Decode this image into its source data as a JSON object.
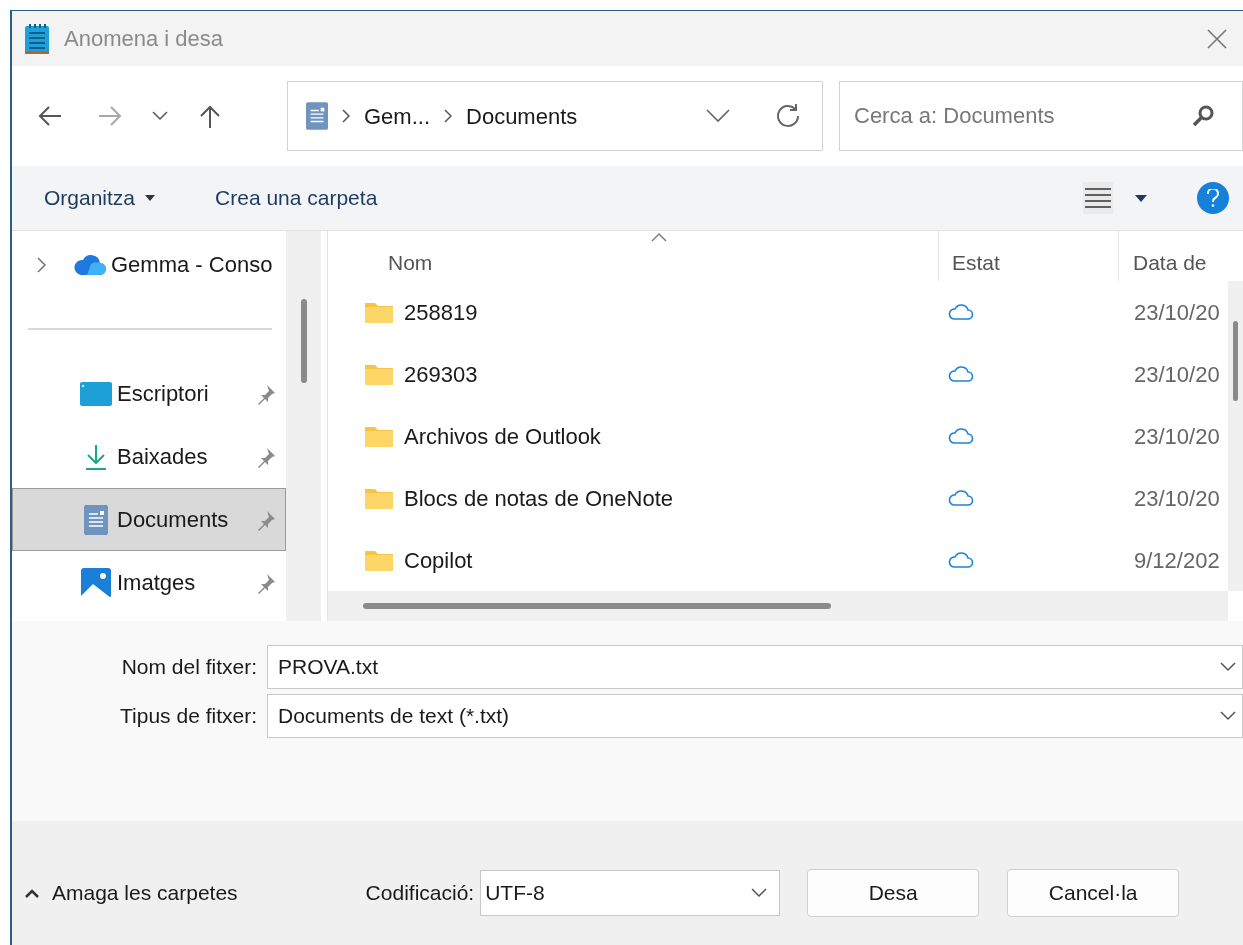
{
  "window": {
    "title": "Anomena i desa"
  },
  "nav": {
    "back_disabled": false,
    "forward_disabled": true,
    "breadcrumb": [
      "Gem...",
      "Documents"
    ],
    "search": {
      "placeholder": "Cerca a: Documents"
    }
  },
  "toolbar": {
    "organize": "Organitza",
    "new_folder": "Crea una carpeta"
  },
  "sidebar": {
    "items": [
      {
        "label": "Gemma - Conso",
        "kind": "cloud",
        "selected": false,
        "pinned": false
      },
      {
        "label": "Escriptori",
        "kind": "desktop",
        "selected": false,
        "pinned": true
      },
      {
        "label": "Baixades",
        "kind": "downloads",
        "selected": false,
        "pinned": true
      },
      {
        "label": "Documents",
        "kind": "documents",
        "selected": true,
        "pinned": true
      },
      {
        "label": "Imatges",
        "kind": "pictures",
        "selected": false,
        "pinned": true
      }
    ]
  },
  "table": {
    "columns": [
      "Nom",
      "Estat",
      "Data de"
    ],
    "rows": [
      {
        "name": "258819",
        "date": "23/10/20"
      },
      {
        "name": "269303",
        "date": "23/10/20"
      },
      {
        "name": "Archivos de Outlook",
        "date": "23/10/20"
      },
      {
        "name": "Blocs de notas de OneNote",
        "date": "23/10/20"
      },
      {
        "name": "Copilot",
        "date": "9/12/202"
      }
    ]
  },
  "fields": [
    {
      "label": "Nom del fitxer:",
      "value": "PROVA.txt"
    },
    {
      "label": "Tipus de fitxer:",
      "value": "Documents de text (*.txt)"
    }
  ],
  "footer": {
    "hide_folders": "Amaga les carpetes",
    "encoding": {
      "label": "Codificació:",
      "value": "UTF-8"
    },
    "buttons": [
      "Desa",
      "Cancel·la"
    ]
  }
}
